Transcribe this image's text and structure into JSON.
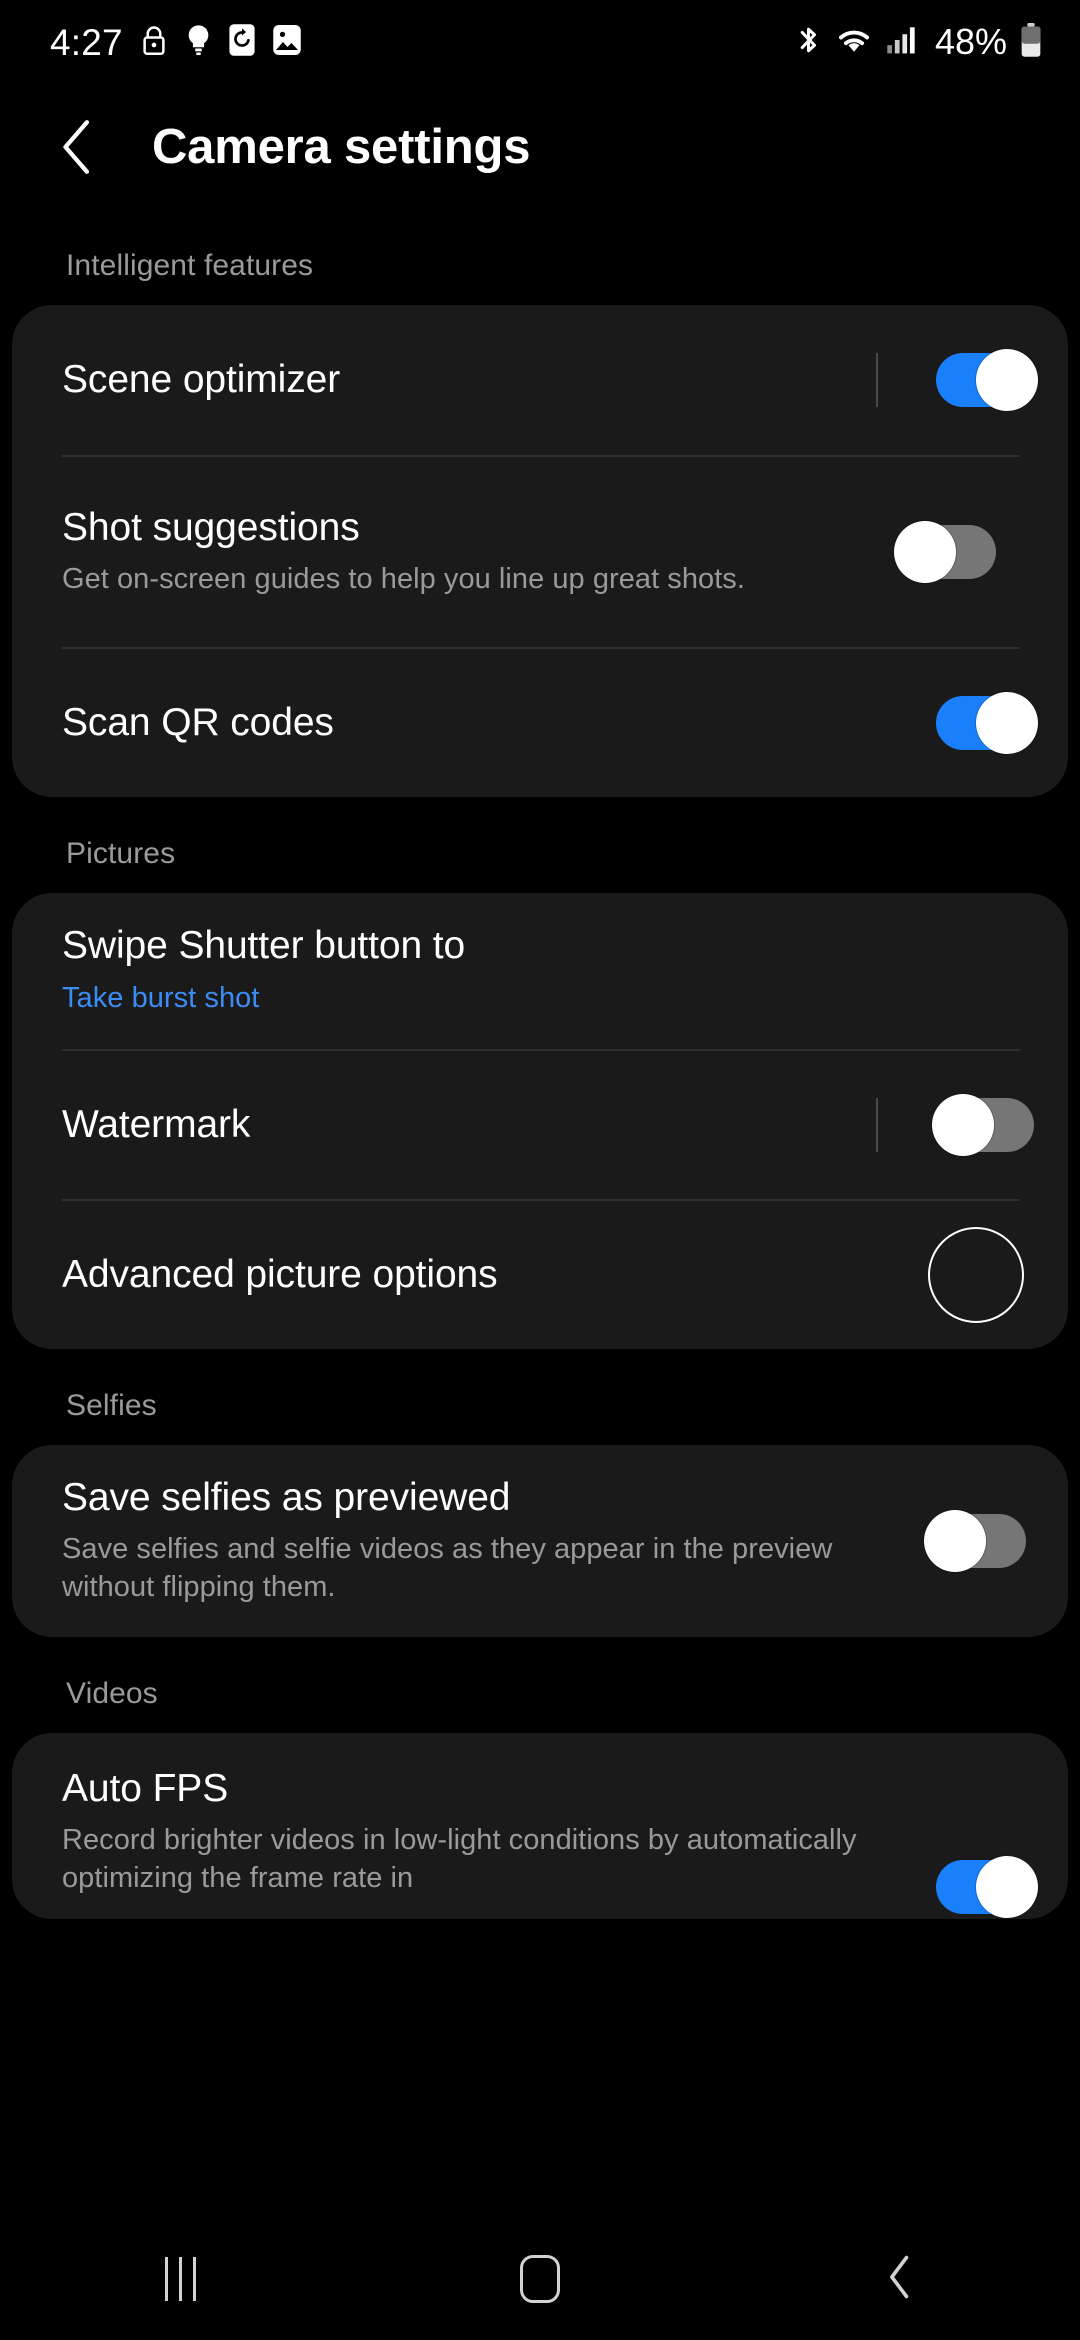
{
  "status_bar": {
    "clock": "4:27",
    "left_icons": [
      "lock-icon",
      "lightbulb-icon",
      "alarm-reset-icon",
      "image-icon"
    ],
    "right_icons": [
      "bluetooth-icon",
      "wifi-icon",
      "cellular-signal-icon"
    ],
    "battery_percent": "48%",
    "battery_icon": "battery-icon"
  },
  "header": {
    "back_icon": "back-chevron-icon",
    "title": "Camera settings"
  },
  "colors": {
    "accent_blue": "#1a7ffa",
    "value_blue": "#3c8cf5",
    "card_bg": "#1a1a1a",
    "page_bg": "#000000",
    "secondary_text": "#9a9a9a",
    "toggle_off": "#767676"
  },
  "sections": [
    {
      "header": "Intelligent features",
      "rows": [
        {
          "title": "Scene optimizer",
          "subtitle": "",
          "value": "",
          "control": "toggle",
          "state": "on",
          "separator": true
        },
        {
          "title": "Shot suggestions",
          "subtitle": "Get on-screen guides to help you line up great shots.",
          "value": "",
          "control": "toggle",
          "state": "off",
          "separator": false
        },
        {
          "title": "Scan QR codes",
          "subtitle": "",
          "value": "",
          "control": "toggle",
          "state": "on",
          "separator": false
        }
      ]
    },
    {
      "header": "Pictures",
      "rows": [
        {
          "title": "Swipe Shutter button to",
          "subtitle": "",
          "value": "Take burst shot",
          "control": "none",
          "state": "",
          "separator": false
        },
        {
          "title": "Watermark",
          "subtitle": "",
          "value": "",
          "control": "toggle",
          "state": "off",
          "separator": true
        },
        {
          "title": "Advanced picture options",
          "subtitle": "",
          "value": "",
          "control": "ripple",
          "state": "",
          "separator": false
        }
      ]
    },
    {
      "header": "Selfies",
      "rows": [
        {
          "title": "Save selfies as previewed",
          "subtitle": "Save selfies and selfie videos as they appear in the preview without flipping them.",
          "value": "",
          "control": "toggle",
          "state": "off",
          "separator": false
        }
      ]
    },
    {
      "header": "Videos",
      "rows": [
        {
          "title": "Auto FPS",
          "subtitle": "Record brighter videos in low-light conditions by automatically optimizing the frame rate in",
          "value": "",
          "control": "toggle",
          "state": "on",
          "separator": false
        }
      ]
    }
  ],
  "nav_bar": {
    "recents": "recents-icon",
    "home": "home-icon",
    "back": "back-icon"
  }
}
